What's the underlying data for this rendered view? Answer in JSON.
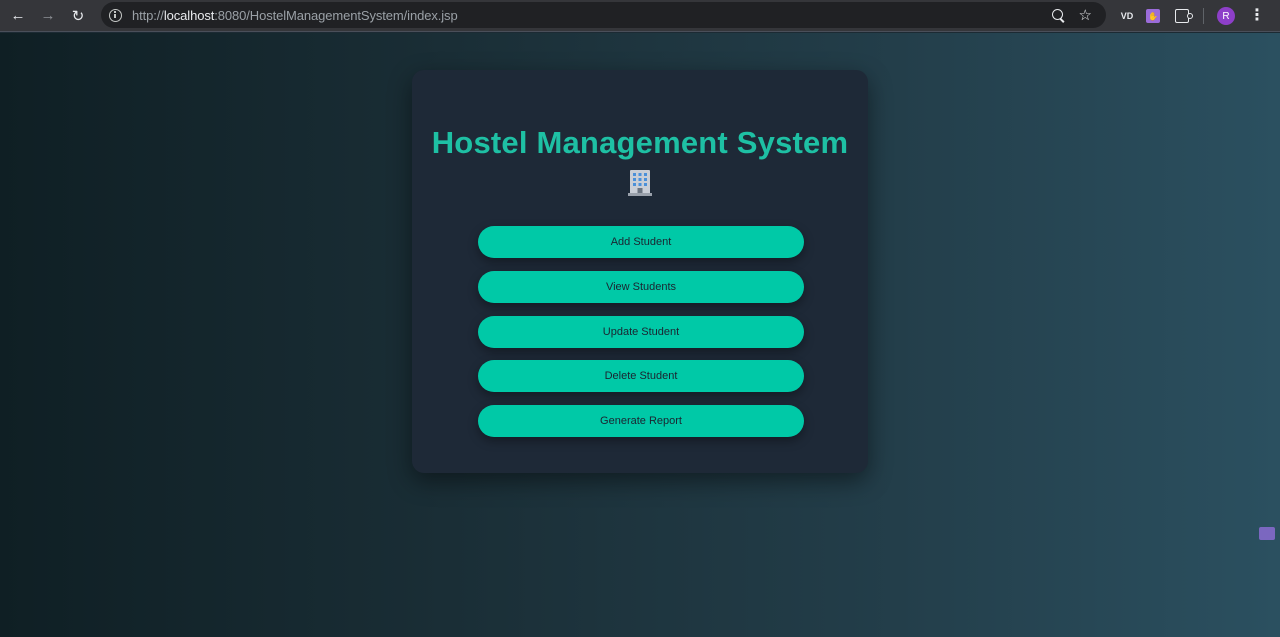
{
  "browser": {
    "url_prefix": "http://",
    "url_host": "localhost",
    "url_rest": ":8080/HostelManagementSystem/index.jsp",
    "extension_vd_label": "VD",
    "avatar_letter": "R"
  },
  "icons": {
    "back": "back-arrow-icon",
    "forward": "forward-arrow-icon",
    "reload": "reload-icon",
    "info": "info-icon",
    "zoom": "zoom-icon",
    "star": "bookmark-star-icon",
    "extensions": "puzzle-icon",
    "menu": "kebab-menu-icon",
    "building": "building-icon"
  },
  "colors": {
    "accent": "#00c9a7",
    "title": "#1ec0a4",
    "card": "#1e2937"
  },
  "main": {
    "title": "Hostel Management System",
    "buttons": [
      {
        "label": "Add Student"
      },
      {
        "label": "View Students"
      },
      {
        "label": "Update Student"
      },
      {
        "label": "Delete Student"
      },
      {
        "label": "Generate Report"
      }
    ]
  }
}
